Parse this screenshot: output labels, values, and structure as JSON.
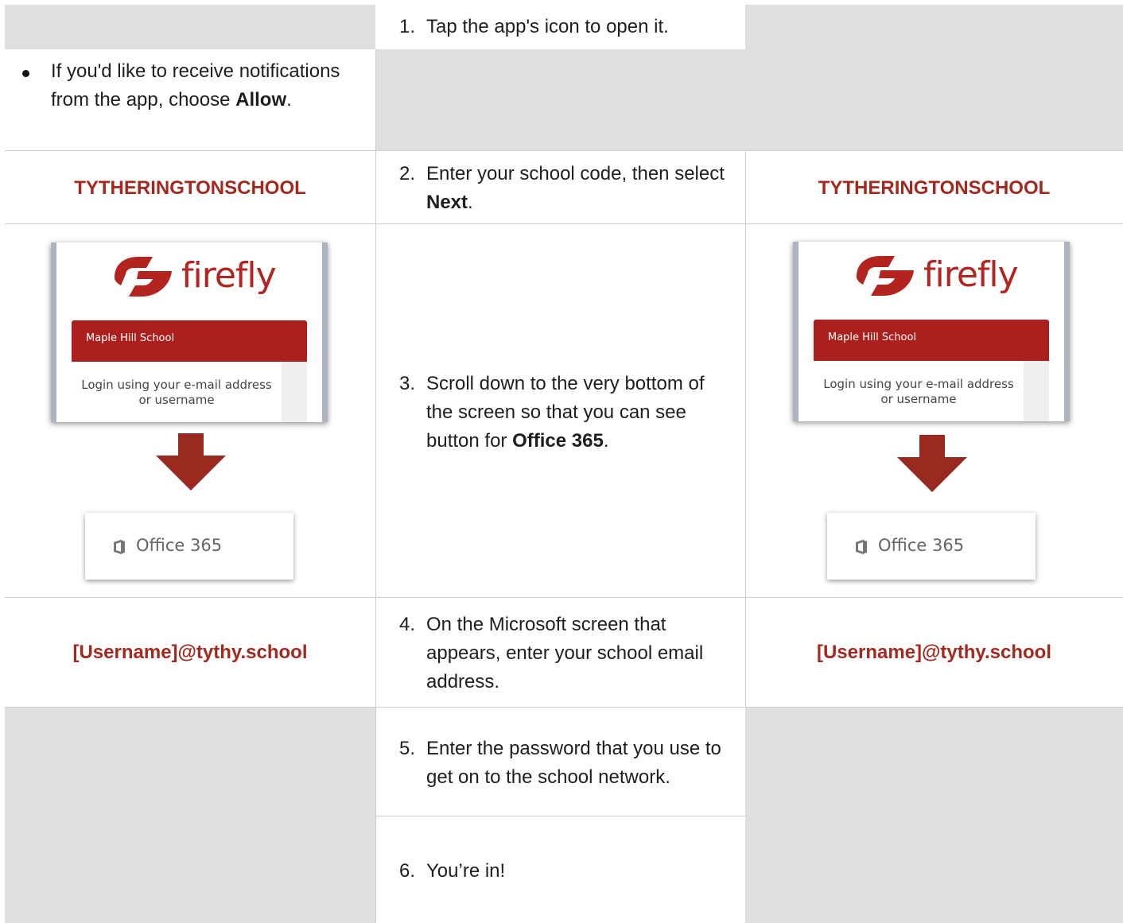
{
  "steps": {
    "s1": "1.",
    "s1_text": "Tap the app's icon to open it.",
    "bullet_pre": "If you'd like to receive notifications from the app, choose ",
    "bullet_bold": "Allow",
    "bullet_post": ".",
    "s2": "2.",
    "s2_pre": "Enter your school code, then select ",
    "s2_bold": "Next",
    "s2_post": ".",
    "s3": "3.",
    "s3_pre": "Scroll down to the very bottom of the screen so that you can see button for ",
    "s3_bold": "Office 365",
    "s3_post": ".",
    "s4": "4.",
    "s4_text": "On the Microsoft screen that appears, enter your school email address.",
    "s5": "5.",
    "s5_text": "Enter the password that you use to get on to the school network.",
    "s6": "6.",
    "s6_text": "You’re in!"
  },
  "school_code": "TYTHERINGTONSCHOOL",
  "email_format": "[Username]@tythy.school",
  "firefly": {
    "wordmark": "firefly",
    "school_name": "Maple Hill School",
    "login_line1": "Login using your e-mail address",
    "login_line2": "or username"
  },
  "office_button": {
    "label": "Office 365",
    "icon": "office-icon"
  },
  "colors": {
    "accent": "#a3291f",
    "brand_red": "#ab1f1c",
    "arrow": "#9a2a1f",
    "cell_gray": "#e0dfdf"
  }
}
